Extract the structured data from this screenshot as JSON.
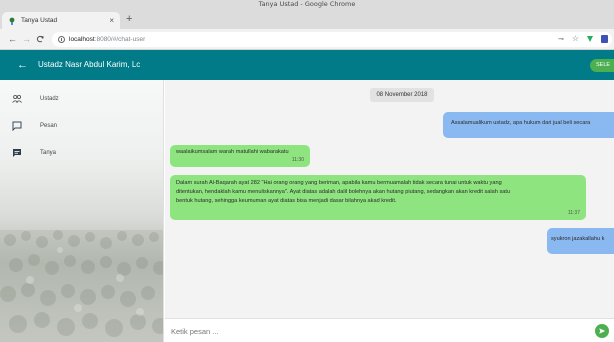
{
  "window": {
    "title": "Tanya Ustad - Google Chrome"
  },
  "tab": {
    "title": "Tanya Ustad",
    "close": "×",
    "new_tab": "+"
  },
  "address_bar": {
    "host": "localhost",
    "path": ":8080/#/chat-user"
  },
  "header": {
    "back": "←",
    "title": "Ustadz Nasr Abdul Karim, Lc",
    "select_label": "SELE",
    "color": "#007b87"
  },
  "sidebar": {
    "items": [
      {
        "label": "Ustadz",
        "icon": "people-icon"
      },
      {
        "label": "Pesan",
        "icon": "chat-outline-icon"
      },
      {
        "label": "Tanya",
        "icon": "chat-filled-icon"
      }
    ]
  },
  "chat": {
    "date": "08 November 2018",
    "messages": [
      {
        "side": "out",
        "text": "Assalamualikum ustadz, apa hukum dari jual beli secara"
      },
      {
        "side": "in",
        "text": "waalaikumsalam warah matullahi wabarakatu",
        "time": "11:30"
      },
      {
        "side": "in",
        "line1": "Dalam surah Al-Baqarah ayat 282 \"Hai orang orang yang beriman, apabila kamu bermuamalah tidak secara tunai untuk waktu yang",
        "line2": "ditentukan, hendaklah kamu menuliskannya\". Ayat diatas adalah dalil bolehnya akan hutang piutang, sedangkan akan kredit salah satu",
        "line3": "bentuk hutang, sehingga keumuman ayat diatas bisa menjadi dasar bilahnya akad kredit.",
        "time": "11:37"
      },
      {
        "side": "out",
        "text": "syukron jazakallahu k"
      }
    ],
    "in_color": "#8ee47f",
    "out_color": "#8ab8f0"
  },
  "input": {
    "placeholder": "Ketik pesan ...",
    "value": ""
  },
  "send": {
    "icon": "send-icon",
    "color": "#4caf50"
  }
}
